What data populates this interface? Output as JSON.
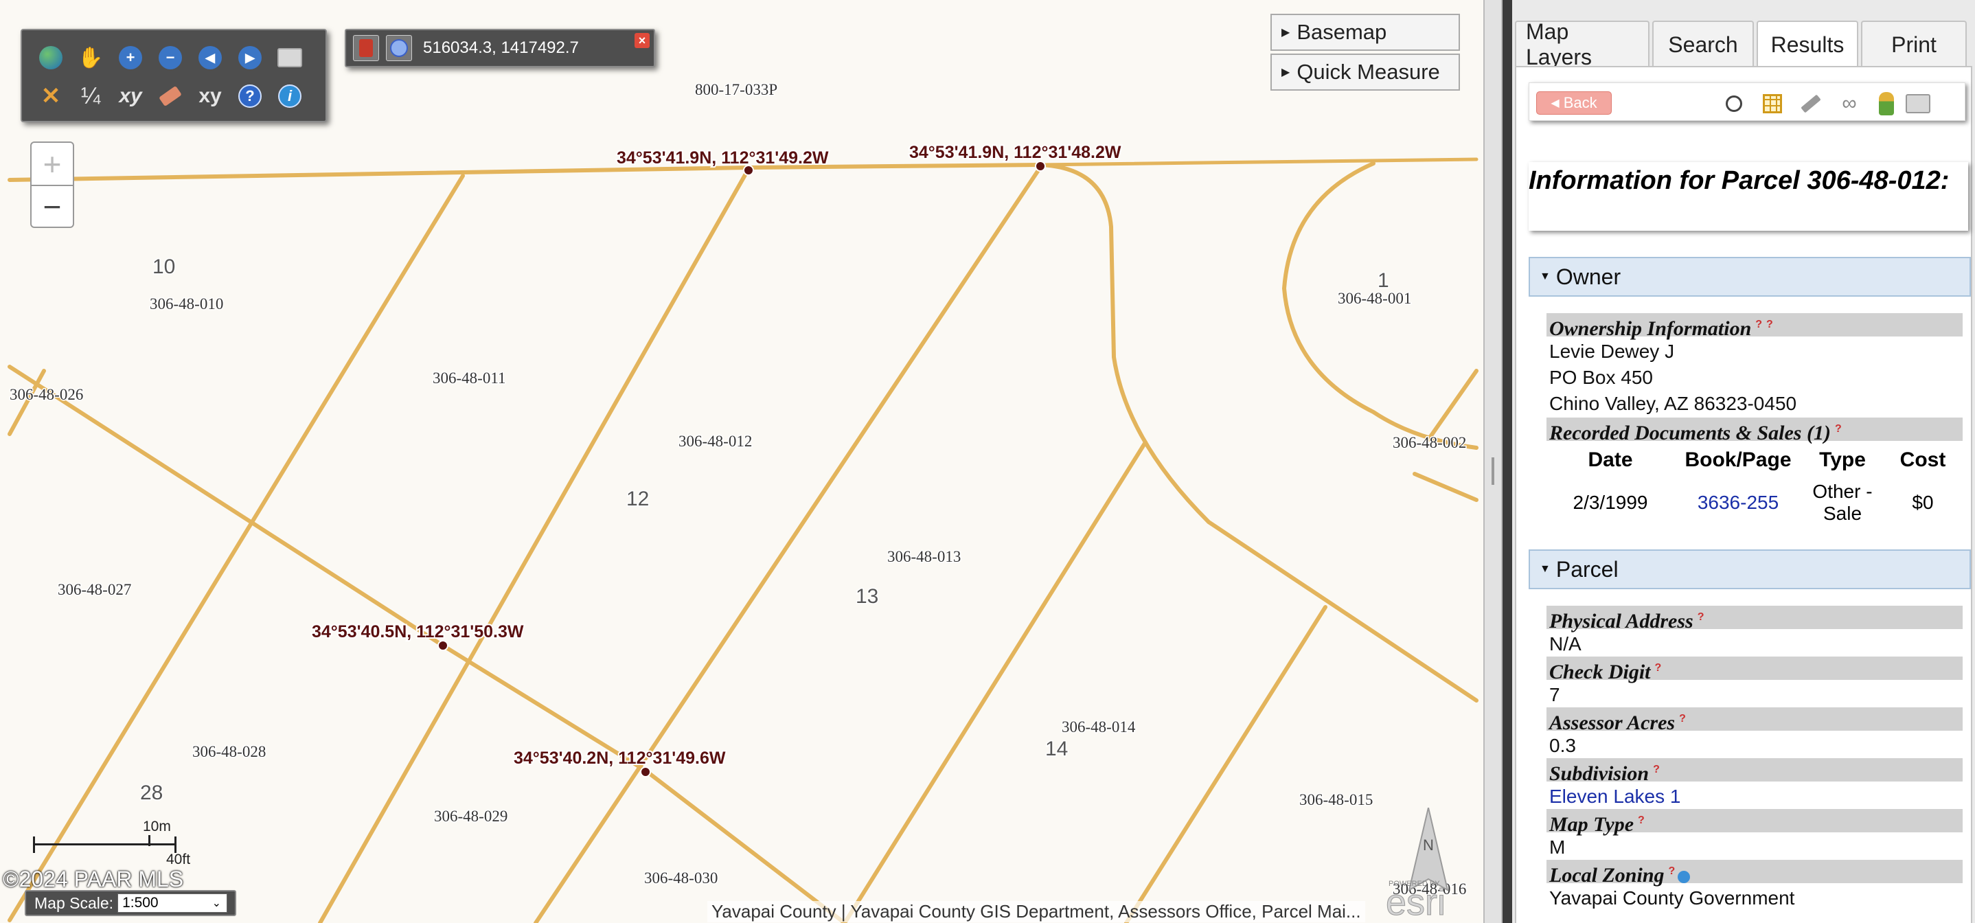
{
  "map": {
    "coord_readout": "516034.3, 1417492.7",
    "top_parcel_label": "800-17-033P",
    "coordinate_markers": [
      {
        "label": "34°53'41.9N, 112°31'49.2W"
      },
      {
        "label": "34°53'41.9N, 112°31'48.2W"
      },
      {
        "label": "34°53'40.5N, 112°31'50.3W"
      },
      {
        "label": "34°53'40.2N, 112°31'49.6W"
      }
    ],
    "parcels": [
      "306-48-010",
      "306-48-011",
      "306-48-012",
      "306-48-013",
      "306-48-014",
      "306-48-015",
      "306-48-026",
      "306-48-027",
      "306-48-028",
      "306-48-029",
      "306-48-030",
      "306-48-001",
      "306-48-002",
      "306-48-016"
    ],
    "lots": [
      "10",
      "12",
      "13",
      "14",
      "28",
      "1"
    ],
    "basemap_label": "Basemap",
    "quick_measure_label": "Quick Measure",
    "zoom_in": "+",
    "zoom_out": "−",
    "scale_top": "10m",
    "scale_bottom": "40ft",
    "copyright": "©2024 PAAR MLS",
    "map_scale_label": "Map Scale:",
    "map_scale_value": "1:500",
    "attribution": "Yavapai County | Yavapai County GIS Department, Assessors Office, Parcel Mai...",
    "esri_powered": "POWERED BY",
    "esri_logo": "esri",
    "north_letter": "N",
    "tools": {
      "fraction_label": "¼",
      "xy_label": "xy",
      "xy_slash_label": "xy"
    }
  },
  "tabs": [
    {
      "label": "Map Layers",
      "active": false
    },
    {
      "label": "Search",
      "active": false
    },
    {
      "label": "Results",
      "active": true
    },
    {
      "label": "Print",
      "active": false
    }
  ],
  "results": {
    "back_label": "Back",
    "title": "Information for Parcel 306-48-012:",
    "owner_section": "Owner",
    "ownership_header": "Ownership Information",
    "owner_name": "Levie Dewey J",
    "owner_address1": "PO Box 450",
    "owner_address2": "Chino Valley, AZ  86323-0450",
    "recorded_header": "Recorded Documents & Sales (1)",
    "docs_columns": [
      "Date",
      "Book/Page",
      "Type",
      "Cost"
    ],
    "docs_rows": [
      {
        "date": "2/3/1999",
        "book_page": "3636-255",
        "type": "Other - Sale",
        "cost": "$0"
      }
    ],
    "parcel_section": "Parcel",
    "fields": [
      {
        "header": "Physical Address",
        "value": "N/A",
        "link": false
      },
      {
        "header": "Check Digit",
        "value": "7",
        "link": false
      },
      {
        "header": "Assessor Acres",
        "value": "0.3",
        "link": false
      },
      {
        "header": "Subdivision",
        "value": "Eleven Lakes 1",
        "link": true
      },
      {
        "header": "Map Type",
        "value": "M",
        "link": false
      },
      {
        "header": "Local Zoning",
        "value": "Yavapai County Government",
        "link": false
      }
    ],
    "help_mark": "?"
  },
  "colors": {
    "parcel_line": "#e3b45c",
    "coord_text": "#5a1010",
    "toolbar_bg": "#4e4e4e",
    "section_bg": "#dde8f4",
    "link": "#1a2fa8"
  }
}
